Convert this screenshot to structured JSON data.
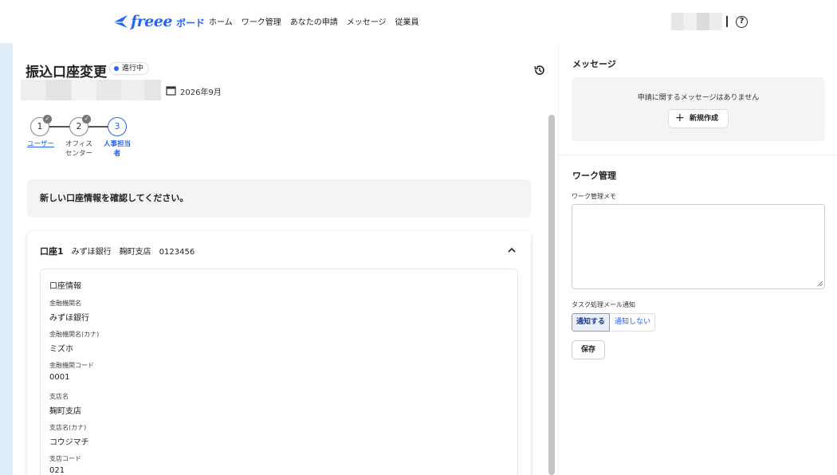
{
  "header": {
    "logo_text": "freee",
    "logo_sub": "ボード",
    "nav": [
      "ホーム",
      "ワーク管理",
      "あなたの申請",
      "メッセージ",
      "従業員"
    ],
    "help_glyph": "?"
  },
  "request": {
    "title": "振込口座変更",
    "status": "進行中",
    "period": "2026年9月"
  },
  "steps": [
    {
      "number": "1",
      "label": "ユーザー",
      "done": true
    },
    {
      "number": "2",
      "label": "オフィス\nセンター",
      "done": true
    },
    {
      "number": "3",
      "label": "人事担当\n者",
      "done": false
    }
  ],
  "instruction": "新しい口座情報を確認してください。",
  "account": {
    "title": "口座1",
    "bank": "みずほ銀行",
    "branch": "麹町支店",
    "number": "0123456",
    "section_title": "口座情報",
    "fields": [
      {
        "label": "金融機関名",
        "value": "みずほ銀行"
      },
      {
        "label": "金融機関名(カナ)",
        "value": "ミズホ"
      },
      {
        "label": "金融機関コード",
        "value": "0001"
      },
      {
        "label": "支店名",
        "value": "麹町支店"
      },
      {
        "label": "支店名(カナ)",
        "value": "コウジマチ"
      },
      {
        "label": "支店コード",
        "value": "021"
      }
    ]
  },
  "messages": {
    "title": "メッセージ",
    "empty": "申請に関するメッセージはありません",
    "new_button": "新規作成"
  },
  "work": {
    "title": "ワーク管理",
    "memo_label": "ワーク管理メモ",
    "memo_value": "",
    "notify_label": "タスク処理メール通知",
    "notify_on": "通知する",
    "notify_off": "通知しない",
    "notify_selected": "通知する",
    "save_button": "保存"
  },
  "colors": {
    "accent": "#2864f0",
    "left_strip": "#dfeef8"
  }
}
